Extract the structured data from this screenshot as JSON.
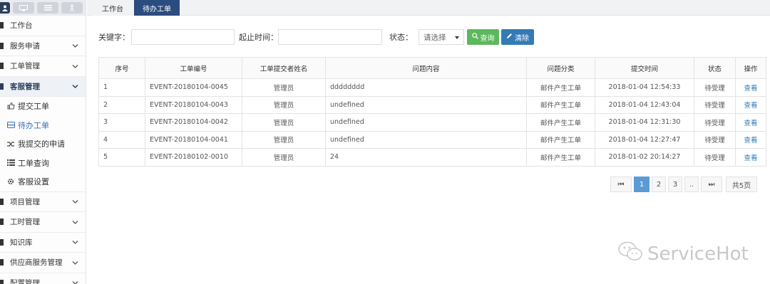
{
  "sidebar": {
    "items": [
      {
        "label": "工作台",
        "icon": "workbench-icon"
      },
      {
        "label": "服务申请",
        "icon": "service-icon"
      },
      {
        "label": "工单管理",
        "icon": "ticket-icon"
      },
      {
        "label": "客服管理",
        "icon": "support-icon",
        "active": true
      },
      {
        "label": "项目管理",
        "icon": "project-icon"
      },
      {
        "label": "工时管理",
        "icon": "clock-icon"
      },
      {
        "label": "知识库",
        "icon": "book-icon"
      },
      {
        "label": "供应商服务管理",
        "icon": "supplier-icon"
      },
      {
        "label": "配置管理",
        "icon": "config-icon"
      }
    ],
    "subitems": [
      {
        "label": "提交工单",
        "icon": "thumb-icon"
      },
      {
        "label": "待办工单",
        "icon": "inbox-icon",
        "active": true
      },
      {
        "label": "我提交的申请",
        "icon": "shuffle-icon"
      },
      {
        "label": "工单查询",
        "icon": "list-icon"
      },
      {
        "label": "客服设置",
        "icon": "gear-icon"
      }
    ]
  },
  "tabs": [
    {
      "label": "工作台"
    },
    {
      "label": "待办工单",
      "active": true
    }
  ],
  "search": {
    "keyword_label": "关键字：",
    "keyword_value": "",
    "time_label": "起止时间：",
    "time_value": "",
    "status_label": "状态：",
    "status_value": "请选择",
    "query_label": "查询",
    "clear_label": "清除"
  },
  "table": {
    "headers": [
      "序号",
      "工单编号",
      "工单提交者姓名",
      "问题内容",
      "问题分类",
      "提交时间",
      "状态",
      "操作"
    ],
    "rows": [
      [
        "1",
        "EVENT-20180104-0045",
        "管理员",
        "dddddddd",
        "邮件产生工单",
        "2018-01-04 12:54:33",
        "待受理",
        "查看"
      ],
      [
        "2",
        "EVENT-20180104-0043",
        "管理员",
        "undefined",
        "邮件产生工单",
        "2018-01-04 12:43:04",
        "待受理",
        "查看"
      ],
      [
        "3",
        "EVENT-20180104-0042",
        "管理员",
        "undefined",
        "邮件产生工单",
        "2018-01-04 12:31:30",
        "待受理",
        "查看"
      ],
      [
        "4",
        "EVENT-20180104-0041",
        "管理员",
        "undefined",
        "邮件产生工单",
        "2018-01-04 12:27:47",
        "待受理",
        "查看"
      ],
      [
        "5",
        "EVENT-20180102-0010",
        "管理员",
        "24",
        "邮件产生工单",
        "2018-01-02 20:14:27",
        "待受理",
        "查看"
      ]
    ]
  },
  "pagination": {
    "first": "⏮",
    "pages": [
      "1",
      "2",
      "3",
      ".."
    ],
    "last": "⏭",
    "total": "共5页",
    "current": "1"
  },
  "watermark": {
    "text": "ServiceHot"
  },
  "colors": {
    "accent": "#2b4c7e",
    "query_btn": "#5cb85c",
    "clear_btn": "#337ab7",
    "link": "#337ab7"
  }
}
